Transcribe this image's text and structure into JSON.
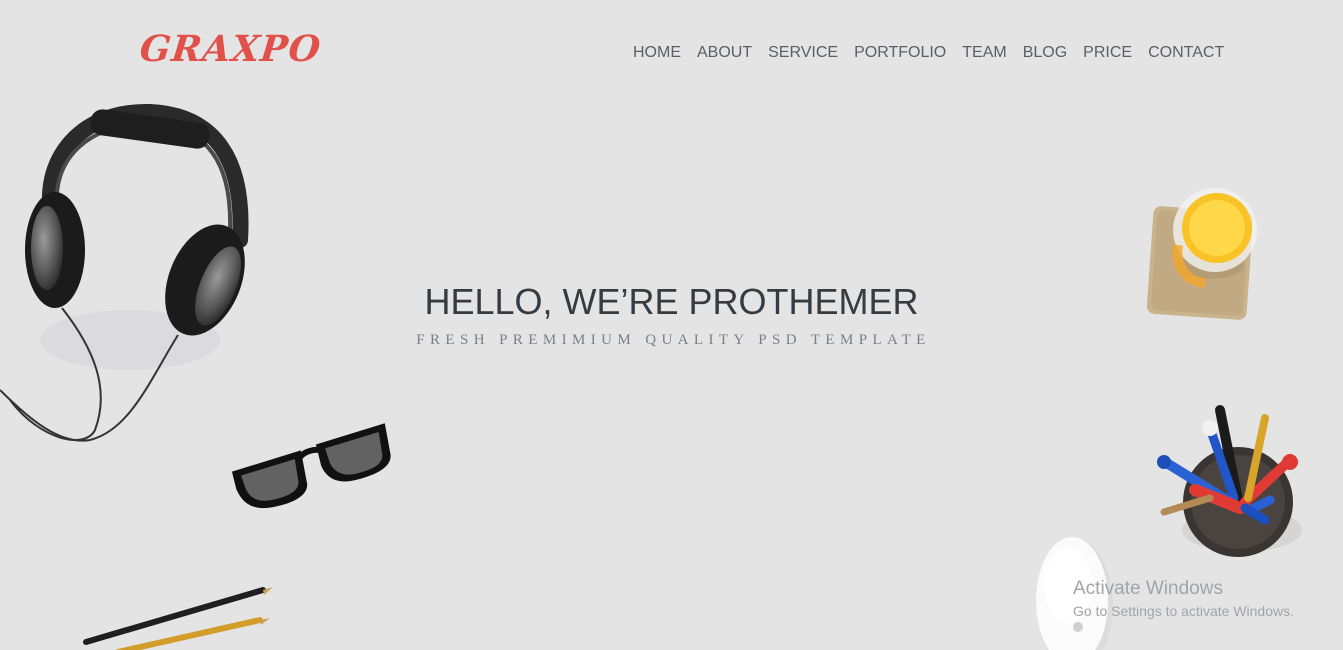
{
  "header": {
    "logo_text": "GRAXPO",
    "nav": [
      {
        "label": "HOME"
      },
      {
        "label": "ABOUT"
      },
      {
        "label": "SERVICE"
      },
      {
        "label": "PORTFOLIO"
      },
      {
        "label": "TEAM"
      },
      {
        "label": "BLOG"
      },
      {
        "label": "PRICE"
      },
      {
        "label": "CONTACT"
      }
    ]
  },
  "hero": {
    "title": "HELLO, WE’RE PROTHEMER",
    "subtitle": "FRESH PREMIMIUM QUALITY PSD TEMPLATE"
  },
  "decorations": {
    "icons": [
      "headphones-icon",
      "glasses-icon",
      "pencils-icon",
      "juice-glass-icon",
      "pen-cup-icon",
      "mouse-icon"
    ]
  },
  "watermark": {
    "title": "Activate Windows",
    "subtitle": "Go to Settings to activate Windows."
  },
  "colors": {
    "background": "#e4e4e5",
    "logo": "#e0514a",
    "nav_text": "#5b5f63",
    "title_text": "#363b40",
    "subtitle_text": "#7b7f84",
    "watermark_text": "#a2a4a7"
  }
}
